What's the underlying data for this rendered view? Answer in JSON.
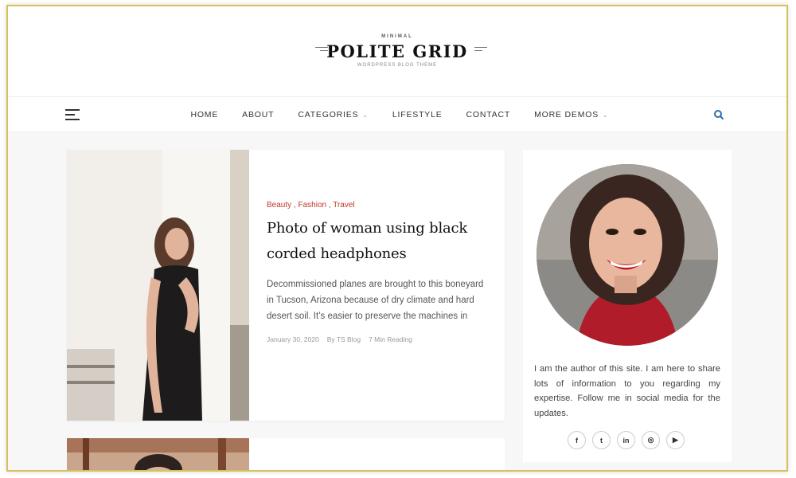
{
  "brand": {
    "tagline_top": "MINIMAL",
    "title": "POLITE GRID",
    "tagline_bottom": "WORDPRESS BLOG THEME"
  },
  "nav": {
    "items": [
      {
        "label": "HOME",
        "has_dropdown": false
      },
      {
        "label": "ABOUT",
        "has_dropdown": false
      },
      {
        "label": "CATEGORIES",
        "has_dropdown": true
      },
      {
        "label": "LIFESTYLE",
        "has_dropdown": false
      },
      {
        "label": "CONTACT",
        "has_dropdown": false
      },
      {
        "label": "MORE DEMOS",
        "has_dropdown": true
      }
    ],
    "search_icon": "search-icon",
    "menu_icon": "hamburger-icon"
  },
  "post": {
    "categories": [
      "Beauty",
      "Fashion",
      "Travel"
    ],
    "title": "Photo of woman using black corded headphones",
    "excerpt": "Decommissioned planes are brought to this boneyard in Tucson, Arizona because of dry climate and hard desert soil. It’s easier to preserve the machines in",
    "date": "January 30, 2020",
    "author": "By TS Blog",
    "reading": "7 Min Reading"
  },
  "sidebar": {
    "about_text": "I am the author of this site. I am here to share lots of information to you regarding my expertise. Follow me in social media for the updates.",
    "socials": [
      {
        "icon": "facebook-icon",
        "glyph": "f"
      },
      {
        "icon": "twitter-icon",
        "glyph": "t"
      },
      {
        "icon": "linkedin-icon",
        "glyph": "in"
      },
      {
        "icon": "instagram-icon",
        "glyph": "◎"
      },
      {
        "icon": "youtube-icon",
        "glyph": "▶"
      }
    ]
  },
  "colors": {
    "accent": "#c0392b",
    "search": "#2a6fb0",
    "frame_border": "#d6c25a"
  }
}
